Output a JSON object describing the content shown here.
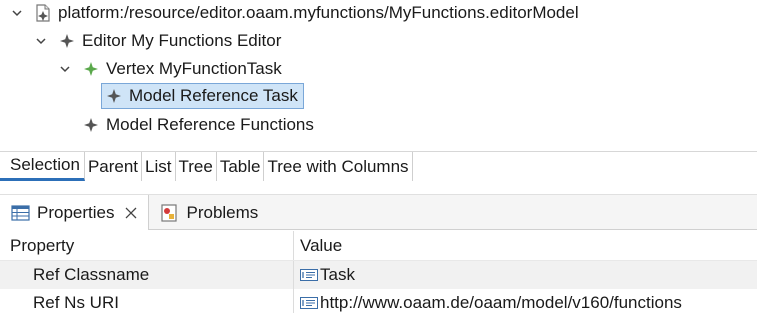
{
  "tree": {
    "root": {
      "label": "platform:/resource/editor.oaam.myfunctions/MyFunctions.editorModel",
      "icon": "model-file-icon"
    },
    "editor": {
      "label": "Editor My Functions Editor",
      "icon": "editor-star-icon"
    },
    "vertex": {
      "label": "Vertex MyFunctionTask",
      "icon": "vertex-star-icon"
    },
    "ref_task": {
      "label": "Model Reference Task",
      "icon": "reference-star-icon"
    },
    "ref_functions": {
      "label": "Model Reference Functions",
      "icon": "reference-star-icon"
    }
  },
  "editor_tabs": [
    {
      "label": "Selection",
      "active": true
    },
    {
      "label": "Parent"
    },
    {
      "label": "List"
    },
    {
      "label": "Tree"
    },
    {
      "label": "Table"
    },
    {
      "label": "Tree with Columns"
    }
  ],
  "views": [
    {
      "label": "Properties",
      "icon": "properties-table-icon",
      "active": true
    },
    {
      "label": "Problems",
      "icon": "problems-icon"
    }
  ],
  "properties": {
    "headers": {
      "property": "Property",
      "value": "Value"
    },
    "rows": [
      {
        "name": "Ref Classname",
        "value": "Task",
        "icon": "text-value-icon"
      },
      {
        "name": "Ref Ns URI",
        "value": "http://www.oaam.de/oaam/model/v160/functions",
        "icon": "text-value-icon"
      }
    ]
  },
  "colors": {
    "selection_bg": "#cfe4f7",
    "selection_border": "#7aa7d8",
    "active_tab_underline": "#2c6fb8",
    "vertex_icon": "#5aa84b"
  }
}
